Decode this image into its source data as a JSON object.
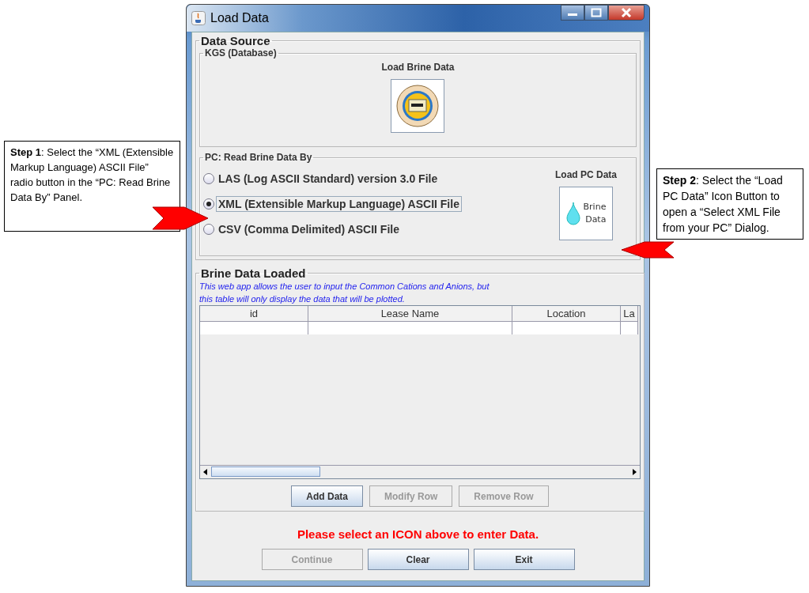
{
  "window": {
    "title": "Load Data"
  },
  "data_source": {
    "title": "Data Source",
    "kgs": {
      "title": "KGS (Database)",
      "button_label": "Load Brine Data"
    },
    "pc": {
      "title": "PC: Read Brine Data By",
      "options": [
        {
          "label": "LAS (Log ASCII Standard) version 3.0 File",
          "selected": false
        },
        {
          "label": "XML (Extensible Markup Language) ASCII File",
          "selected": true
        },
        {
          "label": "CSV (Comma Delimited) ASCII File",
          "selected": false
        }
      ],
      "button_label": "Load PC Data",
      "icon_text": [
        "Brine",
        "Data"
      ]
    }
  },
  "brine_data_loaded": {
    "title": "Brine Data Loaded",
    "note": [
      "This web app allows the user to input the Common Cations and Anions, but",
      "this table will only display the data that will be plotted."
    ],
    "table": {
      "columns": [
        "id",
        "Lease Name",
        "Location",
        "La"
      ]
    }
  },
  "table_buttons": [
    {
      "label": "Add Data",
      "disabled": false
    },
    {
      "label": "Modify Row",
      "disabled": true
    },
    {
      "label": "Remove Row",
      "disabled": true
    }
  ],
  "message": "Please select an ICON above to enter Data.",
  "buttons": [
    {
      "label": "Continue",
      "disabled": true
    },
    {
      "label": "Clear",
      "disabled": false
    },
    {
      "label": "Exit",
      "disabled": false
    }
  ],
  "annotations": [
    {
      "text": "**Step 1**: Select the “XML (Extensible Markup Language) ASCII File” radio button in the “PC: Read Brine Data By” Panel."
    },
    {
      "text": "**Step 2**: Select the “Load PC Data” Icon Button to open a “Select XML File from your PC” Dialog."
    }
  ]
}
